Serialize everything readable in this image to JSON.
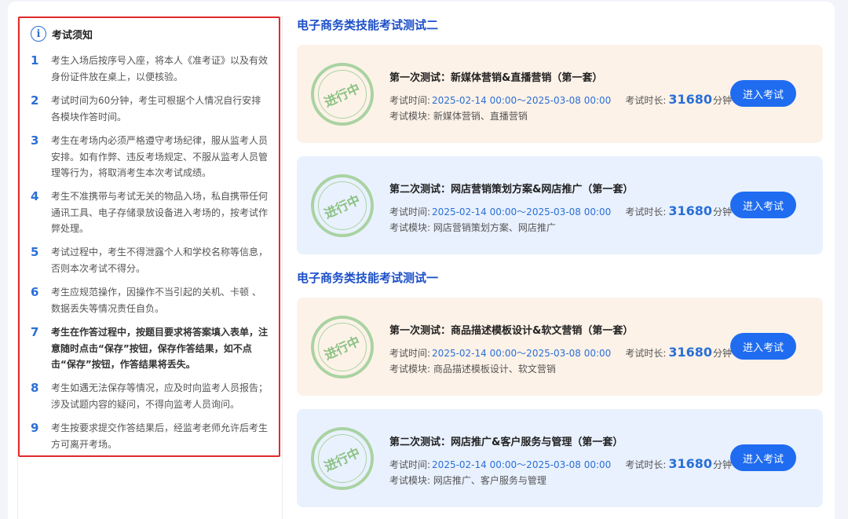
{
  "notice": {
    "title": "考试须知",
    "rules": [
      {
        "num": "1",
        "text": "考生入场后按序号入座，将本人《准考证》以及有效身份证件放在桌上，以便核验。"
      },
      {
        "num": "2",
        "text": "考试时间为60分钟，考生可根据个人情况自行安排各模块作答时间。"
      },
      {
        "num": "3",
        "text": "考生在考场内必须严格遵守考场纪律，服从监考人员安排。如有作弊、违反考场规定、不服从监考人员管理等行为，将取消考生本次考试成绩。"
      },
      {
        "num": "4",
        "text": "考生不准携带与考试无关的物品入场，私自携带任何通讯工具、电子存储录放设备进入考场的，按考试作弊处理。"
      },
      {
        "num": "5",
        "text": "考试过程中，考生不得泄露个人和学校名称等信息，否则本次考试不得分。"
      },
      {
        "num": "6",
        "text": "考生应规范操作，因操作不当引起的关机、卡顿 、数据丢失等情况责任自负。"
      },
      {
        "num": "7",
        "text": "考生在作答过程中，按题目要求将答案填入表单，注意随时点击“保存”按钮，保存作答结果，如不点击“保存”按钮，作答结果将丢失。"
      },
      {
        "num": "8",
        "text": "考生如遇无法保存等情况，应及时向监考人员报告；涉及试题内容的疑问，不得向监考人员询问。"
      },
      {
        "num": "9",
        "text": "考生按要求提交作答结果后，经监考老师允许后考生方可离开考场。"
      }
    ]
  },
  "labels": {
    "stamp": "进行中",
    "time_label": "考试时间:",
    "duration_label": "考试时长:",
    "duration_unit": "分钟",
    "module_label": "考试模块:",
    "enter_button": "进入考试"
  },
  "sections": [
    {
      "title": "电子商务类技能考试测试二",
      "cards": [
        {
          "title": "第一次测试：新媒体营销&直播营销（第一套）",
          "time": "2025-02-14 00:00～2025-03-08 00:00",
          "duration": "31680",
          "modules": "新媒体营销、直播营销"
        },
        {
          "title": "第二次测试：网店营销策划方案&网店推广（第一套）",
          "time": "2025-02-14 00:00～2025-03-08 00:00",
          "duration": "31680",
          "modules": "网店营销策划方案、网店推广"
        }
      ]
    },
    {
      "title": "电子商务类技能考试测试一",
      "cards": [
        {
          "title": "第一次测试：商品描述模板设计&软文营销（第一套）",
          "time": "2025-02-14 00:00～2025-03-08 00:00",
          "duration": "31680",
          "modules": "商品描述模板设计、软文营销"
        },
        {
          "title": "第二次测试：网店推广&客户服务与管理（第一套）",
          "time": "2025-02-14 00:00～2025-03-08 00:00",
          "duration": "31680",
          "modules": "网店推广、客户服务与管理"
        }
      ]
    }
  ],
  "colors": {
    "accent": "#2a6fd6",
    "button": "#1f6cf0",
    "highlight_border": "#e02a2a",
    "card_peach": "#fdf2e8",
    "card_blue": "#e9f1fe",
    "stamp_green": "#a9d3a2"
  }
}
